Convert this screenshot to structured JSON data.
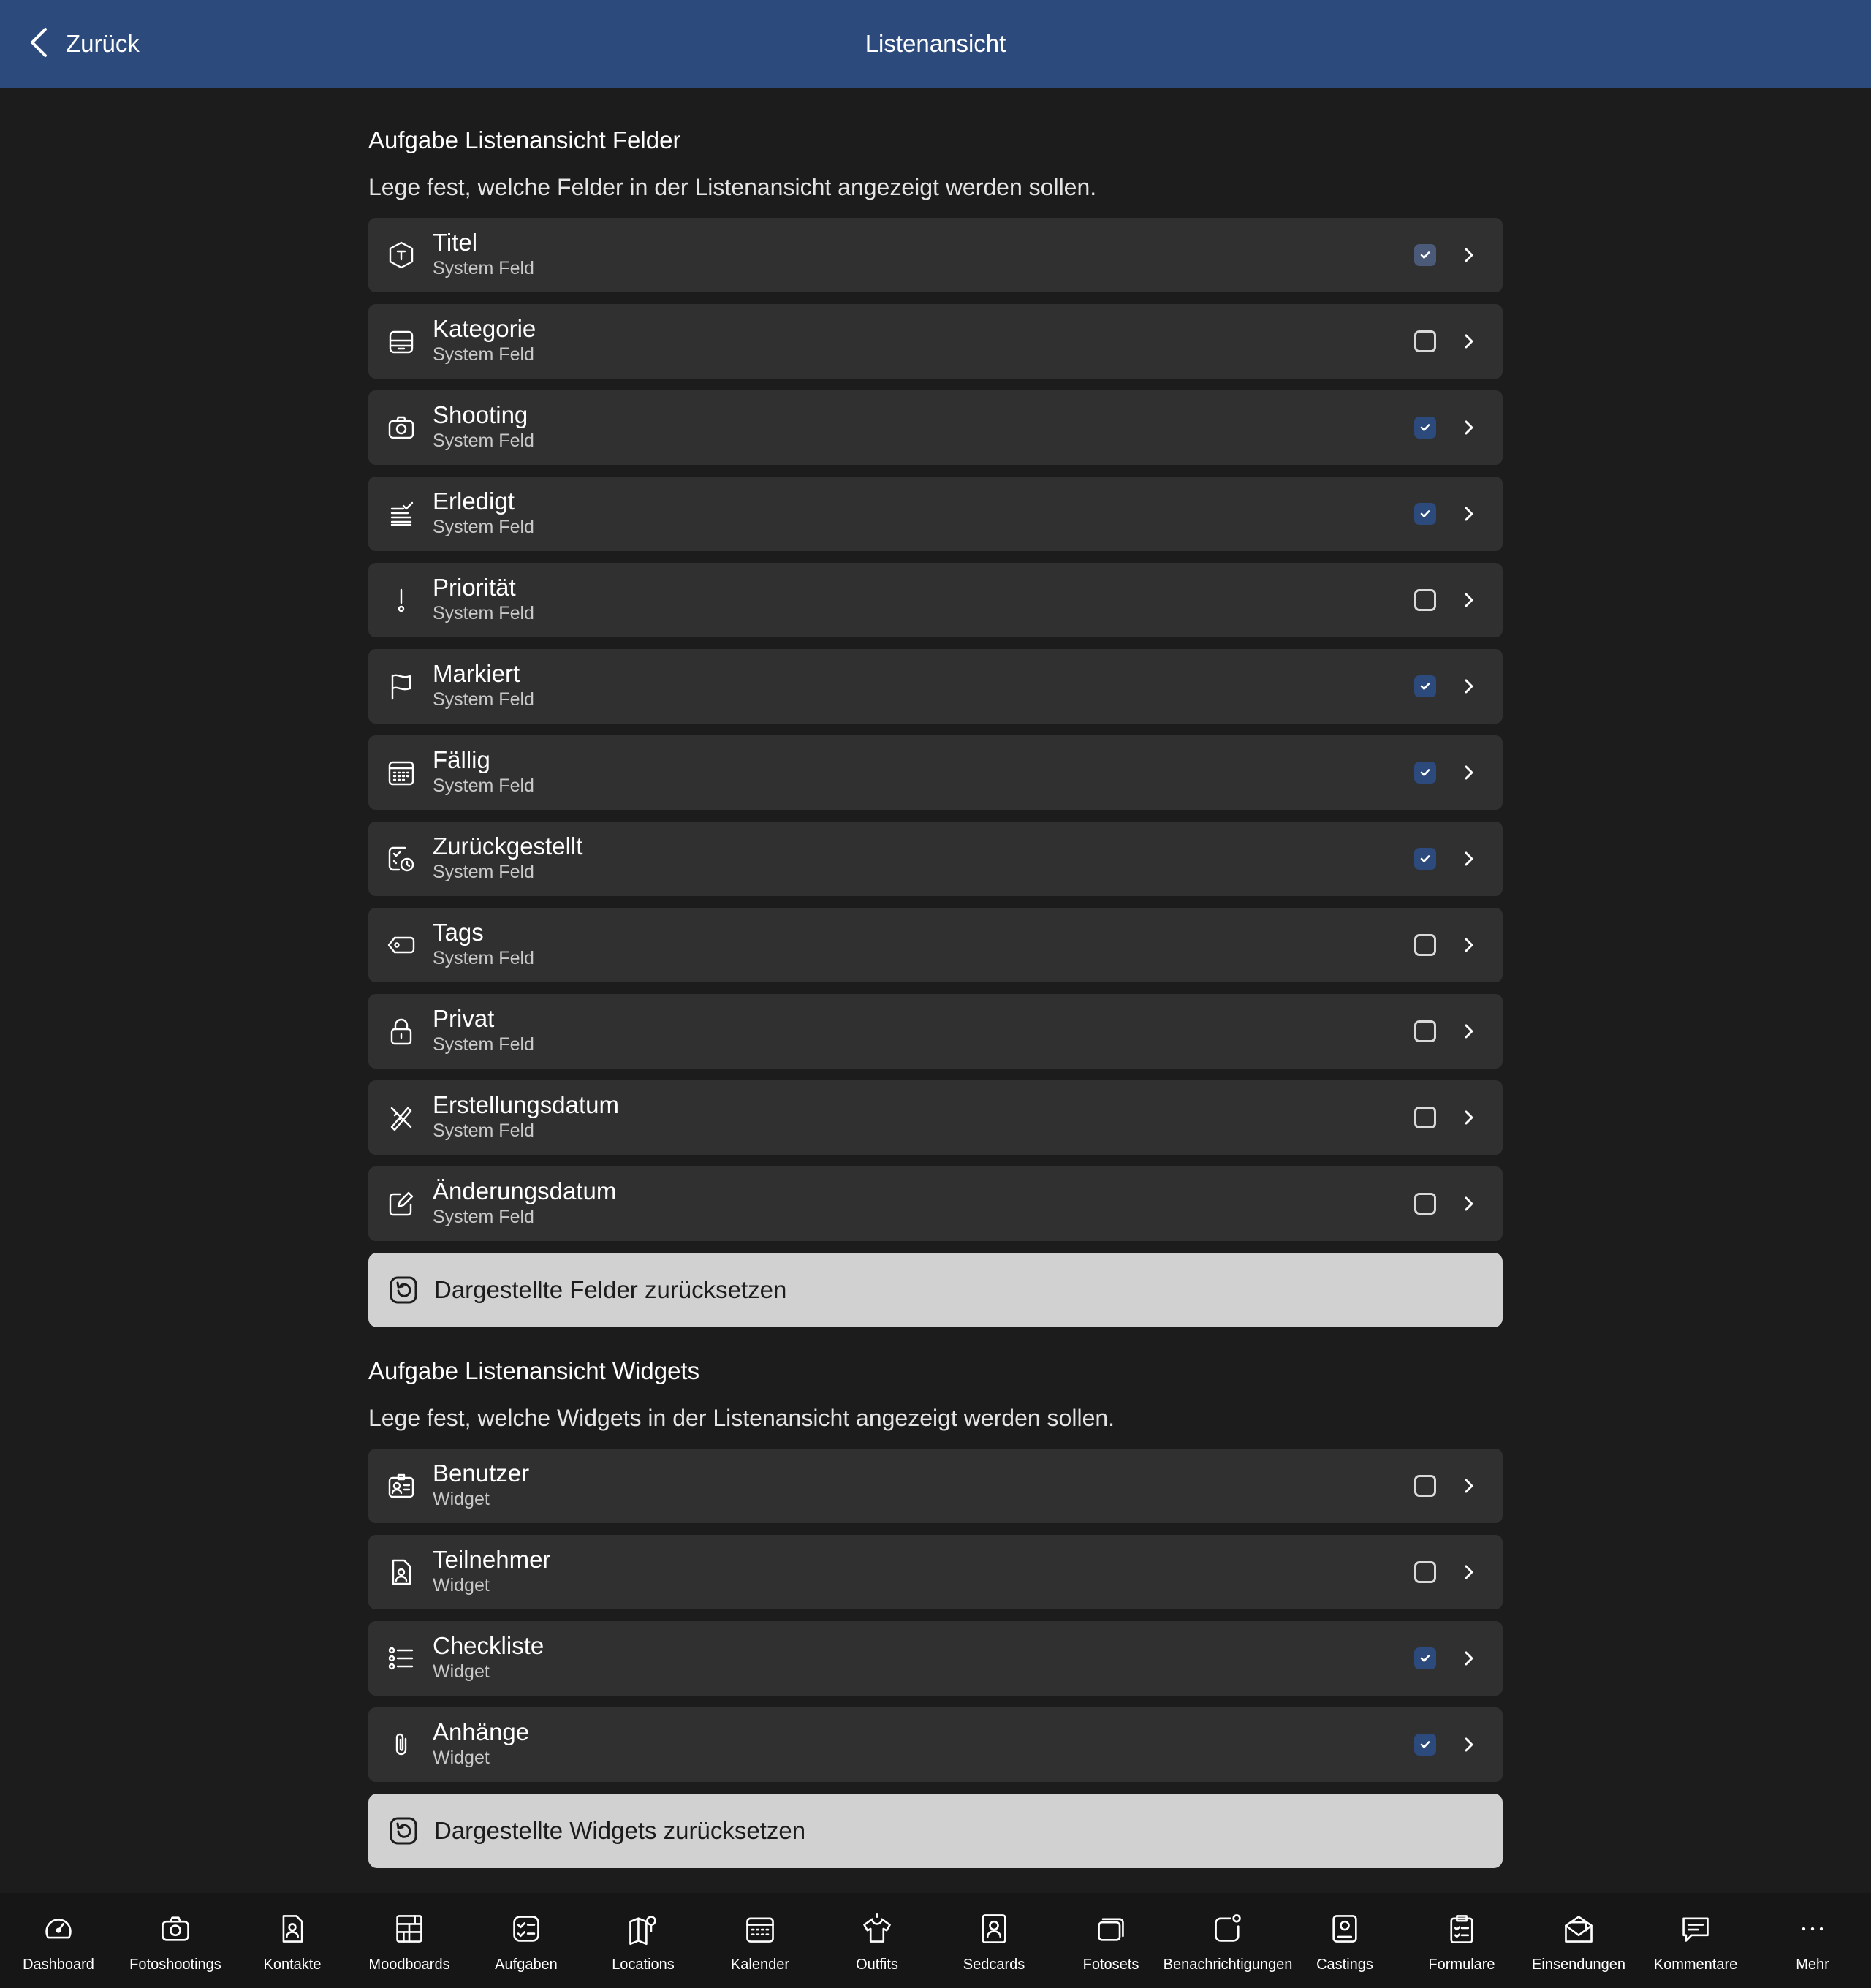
{
  "header": {
    "back_label": "Zurück",
    "title": "Listenansicht"
  },
  "fields_section": {
    "title": "Aufgabe Listenansicht Felder",
    "description": "Lege fest, welche Felder in der Listenansicht angezeigt werden sollen.",
    "reset_label": "Dargestellte Felder zurücksetzen",
    "items": [
      {
        "title": "Titel",
        "subtitle": "System Feld",
        "icon": "title-hexagon-icon",
        "checked": true,
        "disabled": true
      },
      {
        "title": "Kategorie",
        "subtitle": "System Feld",
        "icon": "category-tray-icon",
        "checked": false
      },
      {
        "title": "Shooting",
        "subtitle": "System Feld",
        "icon": "camera-icon",
        "checked": true
      },
      {
        "title": "Erledigt",
        "subtitle": "System Feld",
        "icon": "done-stack-icon",
        "checked": true
      },
      {
        "title": "Priorität",
        "subtitle": "System Feld",
        "icon": "exclamation-icon",
        "checked": false
      },
      {
        "title": "Markiert",
        "subtitle": "System Feld",
        "icon": "flag-icon",
        "checked": true
      },
      {
        "title": "Fällig",
        "subtitle": "System Feld",
        "icon": "calendar-grid-icon",
        "checked": true
      },
      {
        "title": "Zurückgestellt",
        "subtitle": "System Feld",
        "icon": "calendar-clock-icon",
        "checked": true
      },
      {
        "title": "Tags",
        "subtitle": "System Feld",
        "icon": "tag-icon",
        "checked": false
      },
      {
        "title": "Privat",
        "subtitle": "System Feld",
        "icon": "lock-icon",
        "checked": false
      },
      {
        "title": "Erstellungsdatum",
        "subtitle": "System Feld",
        "icon": "pencil-ruler-icon",
        "checked": false
      },
      {
        "title": "Änderungsdatum",
        "subtitle": "System Feld",
        "icon": "edit-square-icon",
        "checked": false
      }
    ]
  },
  "widgets_section": {
    "title": "Aufgabe Listenansicht Widgets",
    "description": "Lege fest, welche Widgets in der Listenansicht angezeigt werden sollen.",
    "reset_label": "Dargestellte Widgets zurücksetzen",
    "items": [
      {
        "title": "Benutzer",
        "subtitle": "Widget",
        "icon": "user-card-icon",
        "checked": false
      },
      {
        "title": "Teilnehmer",
        "subtitle": "Widget",
        "icon": "person-document-icon",
        "checked": false
      },
      {
        "title": "Checkliste",
        "subtitle": "Widget",
        "icon": "checklist-icon",
        "checked": true
      },
      {
        "title": "Anhänge",
        "subtitle": "Widget",
        "icon": "paperclip-icon",
        "checked": true
      }
    ]
  },
  "tabbar": {
    "items": [
      {
        "label": "Dashboard",
        "icon": "speedometer-icon"
      },
      {
        "label": "Fotoshootings",
        "icon": "camera-icon"
      },
      {
        "label": "Kontakte",
        "icon": "contact-icon"
      },
      {
        "label": "Moodboards",
        "icon": "moodboard-icon"
      },
      {
        "label": "Aufgaben",
        "icon": "tasks-icon"
      },
      {
        "label": "Locations",
        "icon": "map-pin-icon"
      },
      {
        "label": "Kalender",
        "icon": "calendar-icon"
      },
      {
        "label": "Outfits",
        "icon": "shirt-icon"
      },
      {
        "label": "Sedcards",
        "icon": "sedcard-icon"
      },
      {
        "label": "Fotosets",
        "icon": "photo-stack-icon"
      },
      {
        "label": "Benachrichtigungen",
        "icon": "notification-icon"
      },
      {
        "label": "Castings",
        "icon": "casting-icon"
      },
      {
        "label": "Formulare",
        "icon": "clipboard-icon"
      },
      {
        "label": "Einsendungen",
        "icon": "mail-icon"
      },
      {
        "label": "Kommentare",
        "icon": "comment-icon"
      },
      {
        "label": "Mehr",
        "icon": "more-dots-icon"
      }
    ]
  },
  "colors": {
    "header": "#2d4a7c",
    "background": "#1c1c1c",
    "row": "#303030",
    "check_on": "#2d4a7c",
    "reset_button": "#d1d1d1"
  }
}
